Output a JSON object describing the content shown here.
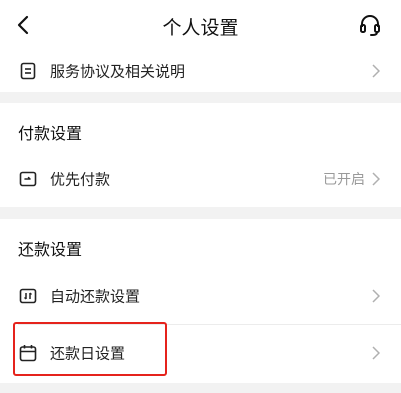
{
  "header": {
    "title": "个人设置",
    "back_icon": "back-arrow-icon",
    "support_icon": "headset-icon"
  },
  "top_item": {
    "label": "服务协议及相关说明",
    "icon": "document-icon"
  },
  "payment_section": {
    "title": "付款设置",
    "items": [
      {
        "label": "优先付款",
        "status": "已开启",
        "icon": "wallet-card-icon"
      }
    ]
  },
  "repayment_section": {
    "title": "还款设置",
    "items": [
      {
        "label": "自动还款设置",
        "icon": "auto-repay-icon"
      },
      {
        "label": "还款日设置",
        "icon": "calendar-icon"
      }
    ]
  },
  "highlight_color": "#e5231c"
}
